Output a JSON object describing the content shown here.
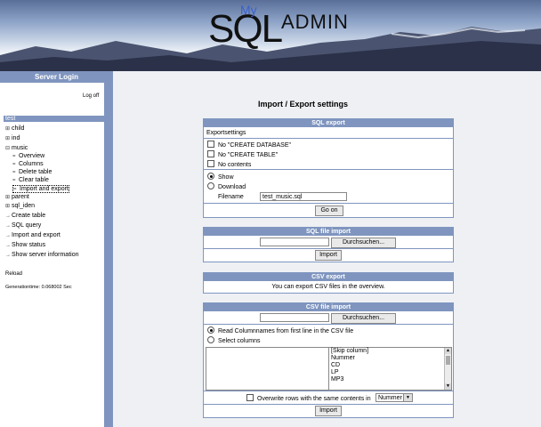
{
  "banner": {
    "logo_sql": "SQL",
    "logo_my": "My",
    "logo_admin": "ADMIN"
  },
  "sidebar": {
    "title": "Server Login",
    "logoff": "Log off",
    "tree": [
      {
        "label": "test",
        "icon": "",
        "selected": true
      },
      {
        "label": "child",
        "icon": "⊞"
      },
      {
        "label": "ind",
        "icon": "⊞"
      },
      {
        "label": "music",
        "icon": "⊟"
      }
    ],
    "music_children": [
      {
        "label": "Overview",
        "icon": "="
      },
      {
        "label": "Columns",
        "icon": "="
      },
      {
        "label": "Delete table",
        "icon": "="
      },
      {
        "label": "Clear table",
        "icon": "="
      },
      {
        "label": "Import and export",
        "icon": "="
      }
    ],
    "tree2": [
      {
        "label": "parent",
        "icon": "⊞"
      },
      {
        "label": "sql_iden",
        "icon": "⊞"
      }
    ],
    "actions": [
      {
        "label": "Create table",
        "icon": "→"
      },
      {
        "label": "SQL query",
        "icon": "→"
      },
      {
        "label": "Import and export",
        "icon": "→"
      },
      {
        "label": "Show status",
        "icon": "→"
      },
      {
        "label": "Show server information",
        "icon": "→"
      }
    ],
    "reload": "Reload",
    "generation_time": "Generationtime: 0.068002 Sec"
  },
  "main": {
    "title": "Import / Export settings",
    "sql_export": {
      "header": "SQL export",
      "exportsettings_label": "Exportsettings",
      "options": [
        "No \"CREATE DATABASE\"",
        "No \"CREATE TABLE\"",
        "No contents"
      ],
      "radio_show": "Show",
      "radio_download": "Download",
      "filename_label": "Filename",
      "filename_value": "test_music.sql",
      "go_button": "Go on"
    },
    "sql_import": {
      "header": "SQL file import",
      "browse_button": "Durchsuchen...",
      "import_button": "Import"
    },
    "csv_export": {
      "header": "CSV export",
      "text": "You can export CSV files in the overview."
    },
    "csv_import": {
      "header": "CSV file import",
      "browse_button": "Durchsuchen...",
      "radio_read": "Read Columnnames from first line in the CSV file",
      "radio_select": "Select columns",
      "columns": [
        "[Skip column]",
        "Nummer",
        "CD",
        "LP",
        "MP3"
      ],
      "overwrite_label": "Overwrite rows with the same contents in",
      "overwrite_select": "Nummer",
      "import_button": "Import"
    }
  },
  "colors": {
    "accent": "#7f95bf",
    "background": "#eef0f4"
  }
}
